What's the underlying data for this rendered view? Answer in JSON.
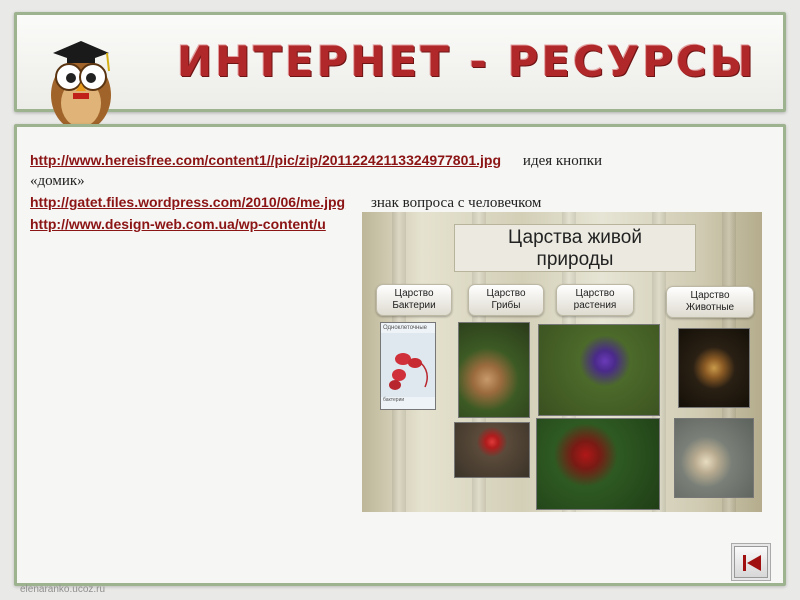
{
  "header": {
    "title": "ИНТЕРНЕТ - РЕСУРСЫ"
  },
  "content": {
    "link1": "http://www.hereisfree.com/content1//pic/zip/20112242113324977801.jpg",
    "desc1": "идея кнопки",
    "desc1b": "«домик»",
    "link2": "http://gatet.files.wordpress.com/2010/06/me.jpg",
    "desc2": "знак вопроса с человечком",
    "link3": "http://www.design-web.com.ua/wp-content/u"
  },
  "embed": {
    "title_line1": "Царства живой",
    "title_line2": "природы",
    "buttons": [
      {
        "line1": "Царство",
        "line2": "Бактерии"
      },
      {
        "line1": "Царство",
        "line2": "Грибы"
      },
      {
        "line1": "Царство",
        "line2": "растения"
      },
      {
        "line1": "Царство",
        "line2": "Животные"
      }
    ],
    "bacteria_caption": "Одноклеточные",
    "bacteria_sub": "бактерии"
  },
  "footer": "elenaranko.ucoz.ru",
  "colors": {
    "accent": "#b0282a",
    "frame": "#9db390",
    "link": "#8b1414"
  }
}
